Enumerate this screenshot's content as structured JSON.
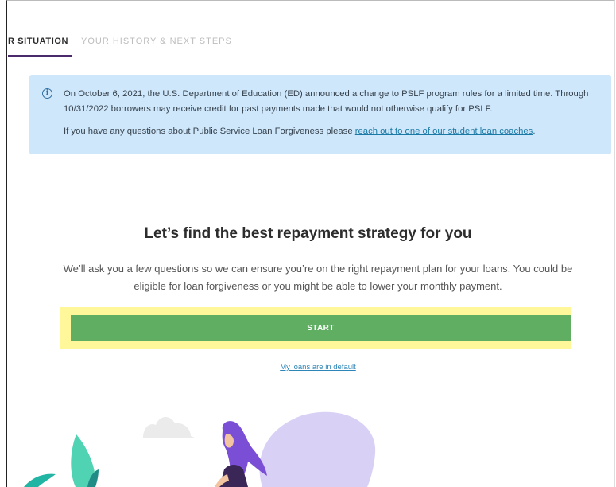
{
  "tabs": {
    "active_label": "R SITUATION",
    "inactive_label": "YOUR HISTORY & NEXT STEPS"
  },
  "notice": {
    "icon": "info-icon",
    "line1": "On October 6, 2021, the U.S. Department of Education (ED) announced a change to PSLF program rules for a limited time. Through 10/31/2022 borrowers may receive credit for past payments made that would not otherwise qualify for PSLF.",
    "line2_prefix": "If you have any questions about Public Service Loan Forgiveness please ",
    "line2_link": "reach out to one of our student loan coaches",
    "line2_suffix": "."
  },
  "main": {
    "headline": "Let’s find the best repayment strategy for you",
    "subtext": "We’ll ask you a few questions so we can ensure you’re on the right repayment plan for your loans. You could be eligible for loan forgiveness or you might be able to lower your monthly payment.",
    "start_label": "START",
    "default_link": "My loans are in default"
  },
  "colors": {
    "accent_purple": "#4b2a6b",
    "notice_bg": "#cfe7fb",
    "start_green": "#5fae62",
    "highlight_yellow": "#fff79a",
    "link_blue": "#2e86b8"
  }
}
